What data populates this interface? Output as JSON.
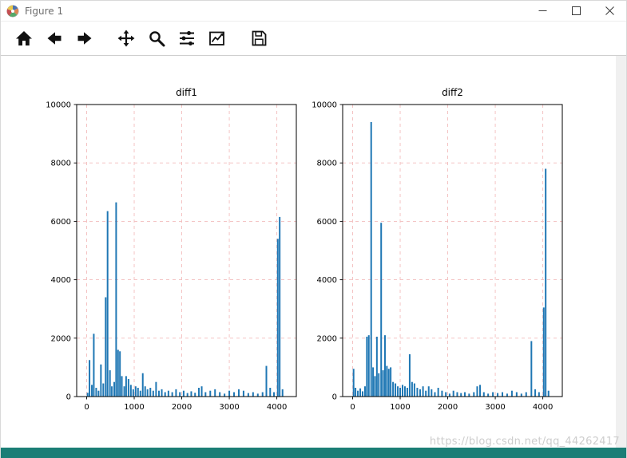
{
  "window": {
    "title": "Figure 1",
    "controls": [
      "minimize",
      "maximize",
      "close"
    ]
  },
  "toolbar": {
    "buttons": [
      "home",
      "back",
      "forward",
      "pan",
      "zoom",
      "configure-subplots",
      "edit-axes",
      "save"
    ]
  },
  "watermark": "https://blog.csdn.net/qq_44262417",
  "colors": {
    "bar": "#1f77b4",
    "grid": "#f3bdbd",
    "accent_bar": "#1b7e76"
  },
  "chart_data": [
    {
      "type": "bar",
      "title": "diff1",
      "xlabel": "",
      "ylabel": "",
      "xlim": [
        -210,
        4410
      ],
      "ylim": [
        0,
        10000
      ],
      "xticks": [
        0,
        1000,
        2000,
        3000,
        4000
      ],
      "yticks": [
        0,
        2000,
        4000,
        6000,
        8000,
        10000
      ],
      "grid": true,
      "points": [
        [
          20,
          130
        ],
        [
          60,
          1250
        ],
        [
          110,
          400
        ],
        [
          150,
          2150
        ],
        [
          200,
          300
        ],
        [
          250,
          200
        ],
        [
          300,
          1100
        ],
        [
          350,
          450
        ],
        [
          400,
          3400
        ],
        [
          440,
          6350
        ],
        [
          490,
          900
        ],
        [
          530,
          350
        ],
        [
          580,
          500
        ],
        [
          620,
          6650
        ],
        [
          660,
          1600
        ],
        [
          700,
          1550
        ],
        [
          740,
          700
        ],
        [
          790,
          350
        ],
        [
          830,
          700
        ],
        [
          880,
          600
        ],
        [
          930,
          400
        ],
        [
          980,
          250
        ],
        [
          1030,
          350
        ],
        [
          1080,
          300
        ],
        [
          1130,
          200
        ],
        [
          1180,
          800
        ],
        [
          1230,
          350
        ],
        [
          1280,
          250
        ],
        [
          1340,
          300
        ],
        [
          1400,
          200
        ],
        [
          1460,
          500
        ],
        [
          1520,
          200
        ],
        [
          1580,
          250
        ],
        [
          1650,
          150
        ],
        [
          1720,
          200
        ],
        [
          1800,
          150
        ],
        [
          1880,
          250
        ],
        [
          1960,
          150
        ],
        [
          2040,
          200
        ],
        [
          2120,
          120
        ],
        [
          2200,
          180
        ],
        [
          2280,
          130
        ],
        [
          2360,
          300
        ],
        [
          2420,
          350
        ],
        [
          2500,
          150
        ],
        [
          2600,
          200
        ],
        [
          2700,
          250
        ],
        [
          2800,
          150
        ],
        [
          2900,
          100
        ],
        [
          3000,
          200
        ],
        [
          3100,
          150
        ],
        [
          3200,
          250
        ],
        [
          3300,
          200
        ],
        [
          3400,
          120
        ],
        [
          3500,
          150
        ],
        [
          3600,
          100
        ],
        [
          3700,
          150
        ],
        [
          3780,
          1050
        ],
        [
          3860,
          300
        ],
        [
          3940,
          150
        ],
        [
          4020,
          5400
        ],
        [
          4060,
          6150
        ],
        [
          4120,
          250
        ]
      ]
    },
    {
      "type": "bar",
      "title": "diff2",
      "xlabel": "",
      "ylabel": "",
      "xlim": [
        -210,
        4410
      ],
      "ylim": [
        0,
        10000
      ],
      "xticks": [
        0,
        1000,
        2000,
        3000,
        4000
      ],
      "yticks": [
        0,
        2000,
        4000,
        6000,
        8000,
        10000
      ],
      "grid": true,
      "points": [
        [
          20,
          950
        ],
        [
          60,
          300
        ],
        [
          110,
          200
        ],
        [
          160,
          280
        ],
        [
          210,
          180
        ],
        [
          260,
          350
        ],
        [
          300,
          2050
        ],
        [
          340,
          2100
        ],
        [
          390,
          9400
        ],
        [
          430,
          1000
        ],
        [
          470,
          700
        ],
        [
          510,
          2050
        ],
        [
          550,
          800
        ],
        [
          600,
          5950
        ],
        [
          640,
          900
        ],
        [
          680,
          2100
        ],
        [
          720,
          1050
        ],
        [
          760,
          950
        ],
        [
          800,
          1000
        ],
        [
          850,
          500
        ],
        [
          900,
          450
        ],
        [
          950,
          350
        ],
        [
          1000,
          300
        ],
        [
          1050,
          400
        ],
        [
          1100,
          350
        ],
        [
          1150,
          300
        ],
        [
          1200,
          1450
        ],
        [
          1250,
          500
        ],
        [
          1300,
          450
        ],
        [
          1360,
          300
        ],
        [
          1420,
          250
        ],
        [
          1480,
          350
        ],
        [
          1540,
          200
        ],
        [
          1600,
          350
        ],
        [
          1660,
          250
        ],
        [
          1730,
          150
        ],
        [
          1800,
          300
        ],
        [
          1880,
          200
        ],
        [
          1960,
          150
        ],
        [
          2040,
          100
        ],
        [
          2120,
          200
        ],
        [
          2200,
          150
        ],
        [
          2280,
          120
        ],
        [
          2360,
          150
        ],
        [
          2450,
          100
        ],
        [
          2550,
          150
        ],
        [
          2620,
          350
        ],
        [
          2680,
          400
        ],
        [
          2760,
          150
        ],
        [
          2850,
          100
        ],
        [
          2950,
          150
        ],
        [
          3050,
          120
        ],
        [
          3150,
          150
        ],
        [
          3250,
          100
        ],
        [
          3350,
          200
        ],
        [
          3450,
          150
        ],
        [
          3550,
          100
        ],
        [
          3650,
          150
        ],
        [
          3760,
          1900
        ],
        [
          3840,
          250
        ],
        [
          3920,
          150
        ],
        [
          4020,
          3050
        ],
        [
          4060,
          7800
        ],
        [
          4120,
          200
        ]
      ]
    }
  ]
}
